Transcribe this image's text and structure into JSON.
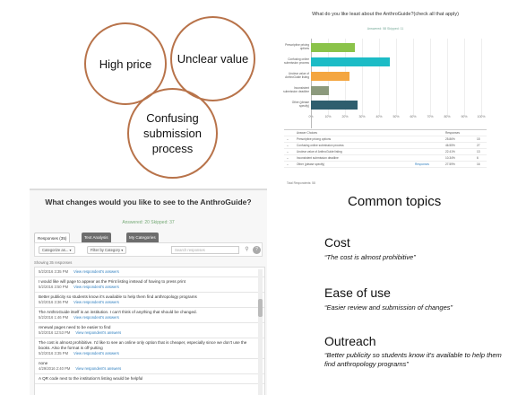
{
  "circles": [
    {
      "text": "High price"
    },
    {
      "text": "Unclear value"
    },
    {
      "text": "Confusing submission process"
    }
  ],
  "chart": {
    "title": "What do you like least about the AnthroGuide?(check all that apply)",
    "counts": "Answered: 58   Skipped: 11",
    "ticks": [
      "0%",
      "10%",
      "20%",
      "30%",
      "40%",
      "50%",
      "60%",
      "70%",
      "80%",
      "90%",
      "100%"
    ],
    "table_headers": [
      "Answer Choices",
      "Responses",
      ""
    ],
    "rows": [
      {
        "label": "Prescriptive pricing options",
        "pct": "25.86%",
        "n": "15"
      },
      {
        "label": "Confusing online submission process",
        "pct": "46.55%",
        "n": "27"
      },
      {
        "label": "Unclear value of AnthroGuide listing",
        "pct": "22.41%",
        "n": "13"
      },
      {
        "label": "Inconsistent submission deadline",
        "pct": "10.34%",
        "n": "6"
      },
      {
        "label": "Other (please specify)",
        "pct": "27.59%",
        "n": "16",
        "link": "Responses"
      }
    ],
    "total": "Total Respondents: 58"
  },
  "chart_data": {
    "type": "bar",
    "orientation": "horizontal",
    "title": "What do you like least about the AnthroGuide?(check all that apply)",
    "categories": [
      "Prescriptive pricing options",
      "Confusing online submission process",
      "Unclear value of AnthroGuide listing",
      "Inconsistent submission deadline",
      "Other (please specify)"
    ],
    "values": [
      25.86,
      46.55,
      22.41,
      10.34,
      27.59
    ],
    "xlim": [
      0,
      100
    ],
    "colors": [
      "#8bc34a",
      "#1cbcc6",
      "#f4a640",
      "#8c9a7d",
      "#2f5e6e"
    ],
    "grid": true
  },
  "openended": {
    "title": "What changes would you like to see to the AnthroGuide?",
    "counts": "Answered: 20   Skipped: 37",
    "tabs": [
      "Responses (35)",
      "Text Analysis",
      "My Categories"
    ],
    "categorize": "Categorize as... ▾",
    "filter": "Filter by Category ▾",
    "search_placeholder": "Search responses",
    "help": "?",
    "showing": "Showing 35 responses",
    "view_link": "View respondent's answers",
    "responses": [
      {
        "text": "",
        "date": "5/2/2016 3:35 PM"
      },
      {
        "text": "I would like will page to appear as the Print listing instead of having to press print",
        "date": "5/2/2016 3:50 PM"
      },
      {
        "text": "Better publicity so students know it's available to help them find anthropology programs",
        "date": "5/2/2016 3:36 PM"
      },
      {
        "text": "The AnthroGuide itself is an institution. I can't think of anything that should be changed.",
        "date": "5/2/2016 1:46 PM"
      },
      {
        "text": "renewal pages need to be easier to find",
        "date": "5/2/2016 12:53 PM"
      },
      {
        "text": "The cost is almost prohibitive. I'd like to see an online only option that is cheaper, especially since we don't use the books. Also the format is off-putting",
        "date": "5/2/2016 3:35 PM"
      },
      {
        "text": "none",
        "date": "4/29/2016 2:40 PM"
      },
      {
        "text": "A QR code next to the institution's listing would be helpful",
        "date": ""
      }
    ]
  },
  "topics": {
    "heading": "Common topics",
    "items": [
      {
        "name": "Cost",
        "quote": "“The cost is almost prohibitive”"
      },
      {
        "name": "Ease of use",
        "quote": "“Easier review and submission of changes”"
      },
      {
        "name": "Outreach",
        "quote": "“Better publicity so students know it's available to help them find anthropology programs”"
      }
    ]
  }
}
